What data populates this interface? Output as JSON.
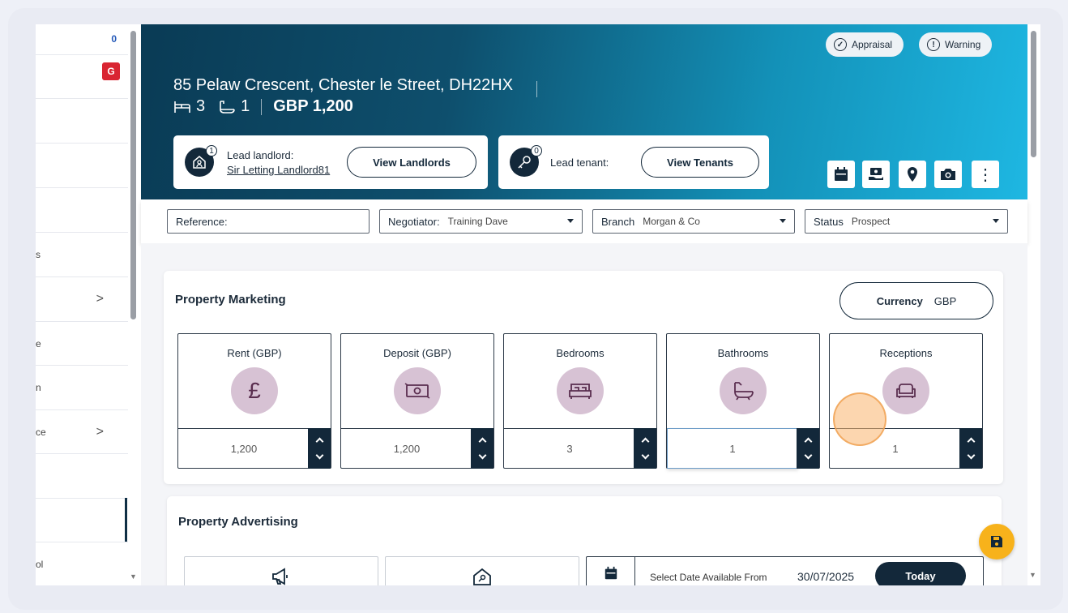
{
  "sidebar": {
    "badge_count": "0",
    "badge_letter": "G",
    "rows": [
      {
        "text": "",
        "chevron": ""
      },
      {
        "text": "",
        "chevron": ""
      },
      {
        "text": "s",
        "chevron": ""
      },
      {
        "text": "",
        "chevron": ">"
      },
      {
        "text": "e",
        "chevron": ""
      },
      {
        "text": "n",
        "chevron": ""
      },
      {
        "text": "ce",
        "chevron": ">"
      },
      {
        "text": "",
        "chevron": ""
      },
      {
        "text": "",
        "chevron": ""
      },
      {
        "text": "ol",
        "chevron": ""
      }
    ],
    "scroll_arrow": "▼"
  },
  "header": {
    "appraisal_label": "Appraisal",
    "warning_label": "Warning",
    "warning_glyph": "!",
    "check_glyph": "✓",
    "address": "85 Pelaw Crescent, Chester le Street, DH22HX",
    "bedrooms": "3",
    "bathrooms": "1",
    "price": "GBP 1,200",
    "landlord": {
      "count": "1",
      "label": "Lead landlord:",
      "name": "Sir Letting Landlord81",
      "button": "View Landlords"
    },
    "tenant": {
      "count": "0",
      "label": "Lead tenant:",
      "button": "View Tenants"
    },
    "more_glyph": "⋮"
  },
  "filters": {
    "reference_label": "Reference:",
    "negotiator_label": "Negotiator:",
    "negotiator_value": "Training Dave",
    "branch_label": "Branch",
    "branch_value": "Morgan & Co",
    "status_label": "Status",
    "status_value": "Prospect"
  },
  "marketing": {
    "title": "Property Marketing",
    "currency_label": "Currency",
    "currency_value": "GBP",
    "tiles": [
      {
        "label": "Rent (GBP)",
        "value": "1,200",
        "icon": "pound-icon"
      },
      {
        "label": "Deposit (GBP)",
        "value": "1,200",
        "icon": "cash-icon"
      },
      {
        "label": "Bedrooms",
        "value": "3",
        "icon": "bed-icon"
      },
      {
        "label": "Bathrooms",
        "value": "1",
        "icon": "bath-icon"
      },
      {
        "label": "Receptions",
        "value": "1",
        "icon": "sofa-icon"
      }
    ],
    "pound_glyph": "£"
  },
  "advertising": {
    "title": "Property Advertising",
    "date_label": "Select Date Available From",
    "date_value": "30/07/2025",
    "today_button": "Today"
  },
  "colors": {
    "header_start": "#0a3b55",
    "header_end": "#1eb7e2",
    "navy": "#13283a",
    "tile_icon_bg": "#d7c2d4",
    "save_fab": "#f7b21b"
  }
}
